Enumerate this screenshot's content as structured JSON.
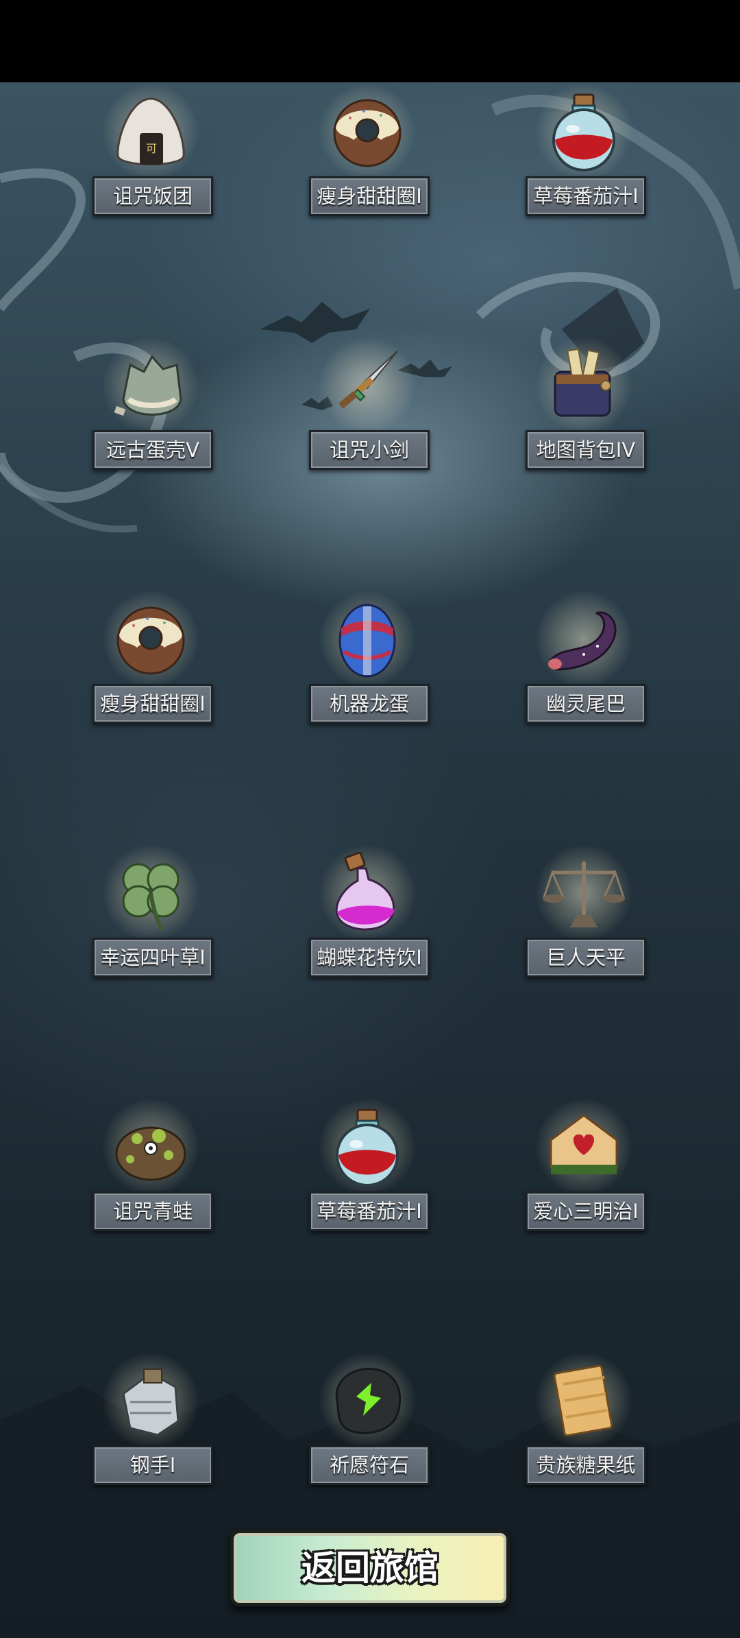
{
  "items": [
    {
      "label": "诅咒饭团",
      "icon": "rice-ball-icon"
    },
    {
      "label": "瘦身甜甜圈I",
      "icon": "donut-icon"
    },
    {
      "label": "草莓番茄汁I",
      "icon": "red-potion-icon"
    },
    {
      "label": "远古蛋壳V",
      "icon": "egg-shell-icon"
    },
    {
      "label": "诅咒小剑",
      "icon": "dagger-icon"
    },
    {
      "label": "地图背包IV",
      "icon": "map-backpack-icon"
    },
    {
      "label": "瘦身甜甜圈I",
      "icon": "donut-icon"
    },
    {
      "label": "机器龙蛋",
      "icon": "robot-dragon-egg-icon"
    },
    {
      "label": "幽灵尾巴",
      "icon": "ghost-tail-icon"
    },
    {
      "label": "幸运四叶草I",
      "icon": "four-leaf-clover-icon"
    },
    {
      "label": "蝴蝶花特饮I",
      "icon": "pink-potion-icon"
    },
    {
      "label": "巨人天平",
      "icon": "scale-icon"
    },
    {
      "label": "诅咒青蛙",
      "icon": "cursed-frog-icon"
    },
    {
      "label": "草莓番茄汁I",
      "icon": "red-potion-icon"
    },
    {
      "label": "爱心三明治I",
      "icon": "heart-sandwich-icon"
    },
    {
      "label": "钢手I",
      "icon": "steel-gauntlet-icon"
    },
    {
      "label": "祈愿符石",
      "icon": "wish-rune-stone-icon"
    },
    {
      "label": "贵族糖果纸",
      "icon": "candy-wrapper-icon"
    }
  ],
  "return_button": {
    "label": "返回旅馆"
  }
}
